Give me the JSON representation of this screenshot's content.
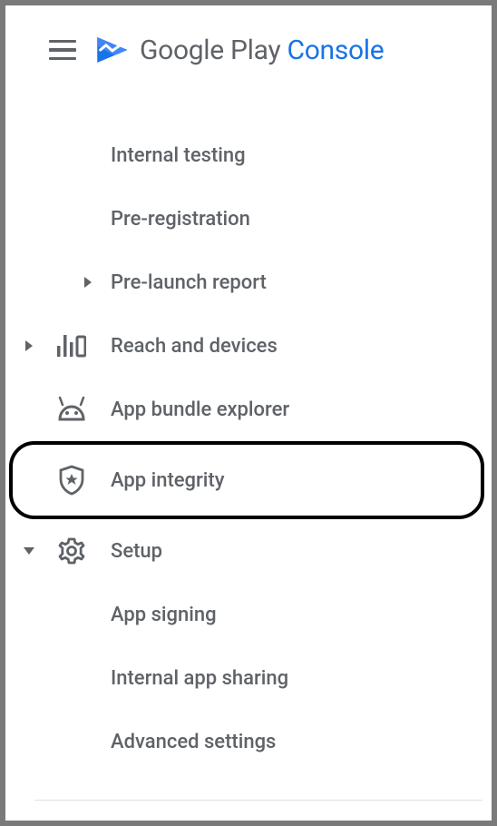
{
  "header": {
    "brand_prefix": "Google Play ",
    "brand_suffix": "Console"
  },
  "nav": {
    "items": [
      {
        "label": "Internal testing"
      },
      {
        "label": "Pre-registration"
      },
      {
        "label": "Pre-launch report"
      },
      {
        "label": "Reach and devices"
      },
      {
        "label": "App bundle explorer"
      },
      {
        "label": "App integrity"
      },
      {
        "label": "Setup"
      },
      {
        "label": "App signing"
      },
      {
        "label": "Internal app sharing"
      },
      {
        "label": "Advanced settings"
      }
    ]
  }
}
